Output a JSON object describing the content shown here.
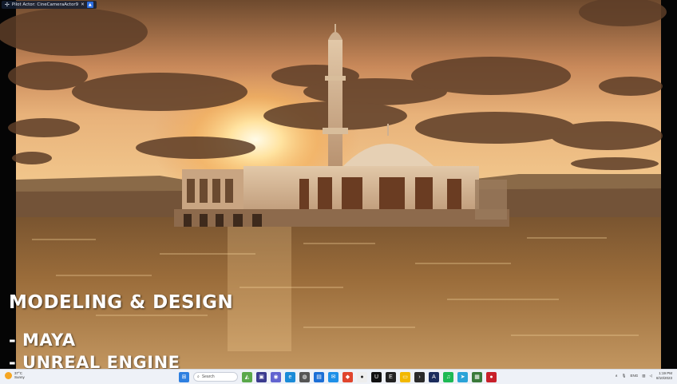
{
  "viewport": {
    "pilot_label": "Pilot Actor: CineCameraActor9"
  },
  "caption": {
    "title": "MODELING & DESIGN",
    "line1": "- MAYA",
    "line2": "- UNREAL ENGINE"
  },
  "taskbar": {
    "weather_temp": "37°C",
    "weather_desc": "Sunny",
    "search_placeholder": "Search",
    "language": "ENG",
    "time": "1:19 PM",
    "date": "8/10/2023"
  },
  "colors": {
    "sky_top": "#8a5a32",
    "sun": "#fff2c0",
    "water": "#6b4826",
    "accent": "#2d6ee0"
  }
}
